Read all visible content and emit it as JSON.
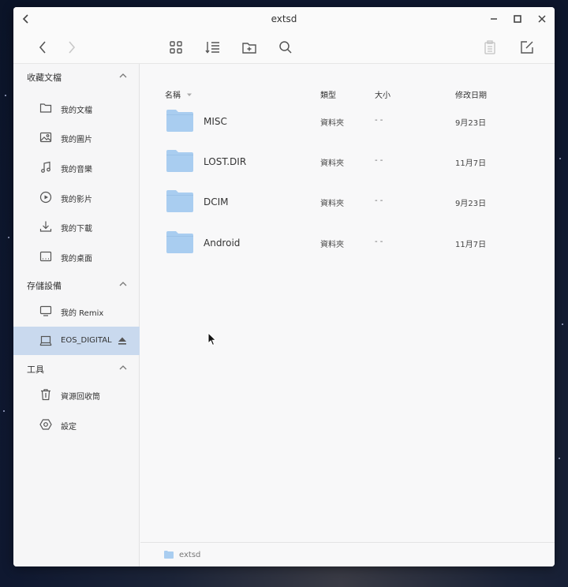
{
  "window": {
    "title": "extsd"
  },
  "toolbar": {
    "icons": [
      "back-arrow-icon",
      "forward-arrow-icon",
      "grid-view-icon",
      "list-view-icon",
      "new-folder-icon",
      "search-icon",
      "clipboard-icon",
      "edit-icon"
    ]
  },
  "sidebar": {
    "sections": [
      {
        "title": "收藏文檔",
        "items": [
          {
            "label": "我的文檔",
            "icon": "folder-icon"
          },
          {
            "label": "我的圖片",
            "icon": "image-icon"
          },
          {
            "label": "我的音樂",
            "icon": "music-note-icon"
          },
          {
            "label": "我的影片",
            "icon": "play-circle-icon"
          },
          {
            "label": "我的下載",
            "icon": "download-icon"
          },
          {
            "label": "我的桌面",
            "icon": "desktop-icon"
          }
        ]
      },
      {
        "title": "存儲設備",
        "items": [
          {
            "label": "我的 Remix",
            "icon": "monitor-icon"
          },
          {
            "label": "EOS_DIGITAL",
            "icon": "drive-icon",
            "selected": true
          }
        ]
      },
      {
        "title": "工具",
        "items": [
          {
            "label": "資源回收筒",
            "icon": "trash-icon"
          },
          {
            "label": "設定",
            "icon": "settings-icon"
          }
        ]
      }
    ]
  },
  "columns": {
    "name": "名稱",
    "type": "類型",
    "size": "大小",
    "modified": "修改日期"
  },
  "files": [
    {
      "name": "MISC",
      "type": "資料夾",
      "size": "- -",
      "modified": "9月23日"
    },
    {
      "name": "LOST.DIR",
      "type": "資料夾",
      "size": "- -",
      "modified": "11月7日"
    },
    {
      "name": "DCIM",
      "type": "資料夾",
      "size": "- -",
      "modified": "9月23日"
    },
    {
      "name": "Android",
      "type": "資料夾",
      "size": "- -",
      "modified": "11月7日"
    }
  ],
  "statusbar": {
    "path": "extsd"
  },
  "colors": {
    "folder": "#a9cdf0",
    "selected": "#c9d9ee",
    "window": "#f8f8f9"
  }
}
